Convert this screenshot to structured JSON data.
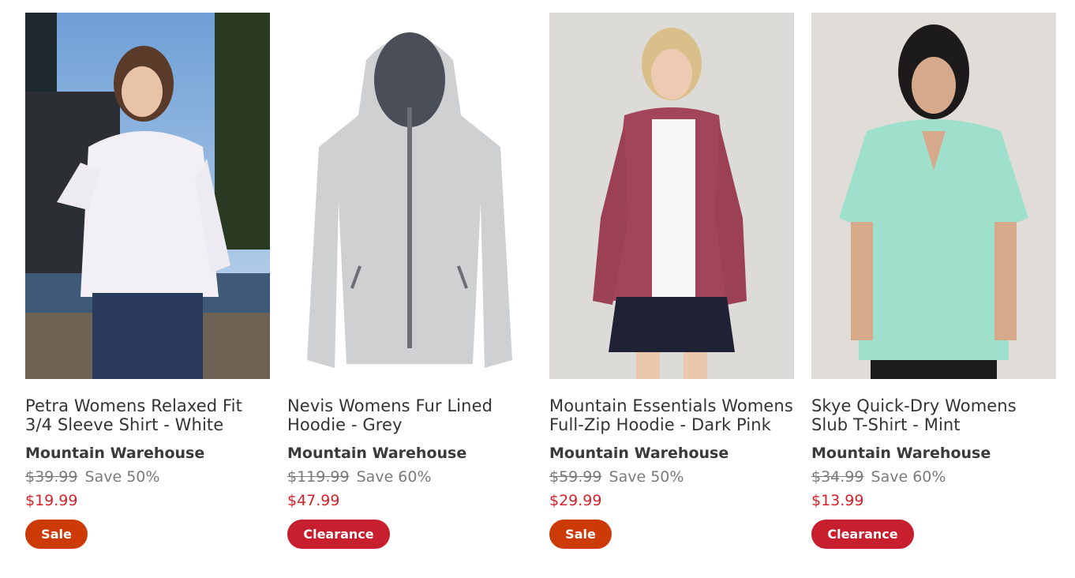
{
  "products": [
    {
      "title": "Petra Womens Relaxed Fit 3/4 Sleeve Shirt - White",
      "brand": "Mountain Warehouse",
      "original_price": "$39.99",
      "save": "Save 50%",
      "price": "$19.99",
      "badge": "Sale",
      "badge_color": "#cc3a06"
    },
    {
      "title": "Nevis Womens Fur Lined Hoodie - Grey",
      "brand": "Mountain Warehouse",
      "original_price": "$119.99",
      "save": "Save 60%",
      "price": "$47.99",
      "badge": "Clearance",
      "badge_color": "#c81f2e"
    },
    {
      "title": "Mountain Essentials Womens Full-Zip Hoodie - Dark Pink",
      "brand": "Mountain Warehouse",
      "original_price": "$59.99",
      "save": "Save 50%",
      "price": "$29.99",
      "badge": "Sale",
      "badge_color": "#cc3a06"
    },
    {
      "title": "Skye Quick-Dry Womens Slub T-Shirt - Mint",
      "brand": "Mountain Warehouse",
      "original_price": "$34.99",
      "save": "Save 60%",
      "price": "$13.99",
      "badge": "Clearance",
      "badge_color": "#c81f2e"
    }
  ],
  "colors": {
    "sale_price": "#d6202a",
    "strikethrough": "#7a7a7a"
  }
}
